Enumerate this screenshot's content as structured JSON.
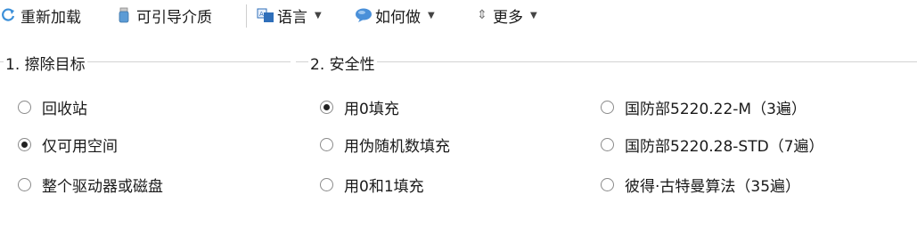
{
  "toolbar": {
    "reload_label": "重新加载",
    "bootable_label": "可引导介质",
    "language_label": "语言",
    "howto_label": "如何做",
    "more_label": "更多",
    "caret": "▼",
    "more_glyph": "⇕"
  },
  "groups": {
    "erase_target_title": "1. 擦除目标",
    "security_title": "2. 安全性"
  },
  "erase_target": {
    "options": [
      {
        "label": "回收站",
        "checked": false
      },
      {
        "label": "仅可用空间",
        "checked": true
      },
      {
        "label": "整个驱动器或磁盘",
        "checked": false
      }
    ]
  },
  "security": {
    "col1": [
      {
        "label": "用0填充",
        "checked": true
      },
      {
        "label": "用伪随机数填充",
        "checked": false
      },
      {
        "label": "用0和1填充",
        "checked": false
      }
    ],
    "col2": [
      {
        "label": "国防部5220.22-M（3遍）",
        "checked": false
      },
      {
        "label": "国防部5220.28-STD（7遍）",
        "checked": false
      },
      {
        "label": "彼得·古特曼算法（35遍）",
        "checked": false
      }
    ]
  },
  "colors": {
    "reload_icon": "#3b8fd9",
    "usb_icon": "#5b9bd5",
    "lang_icon": "#2f6fba",
    "howto_icon": "#4a90d9"
  }
}
